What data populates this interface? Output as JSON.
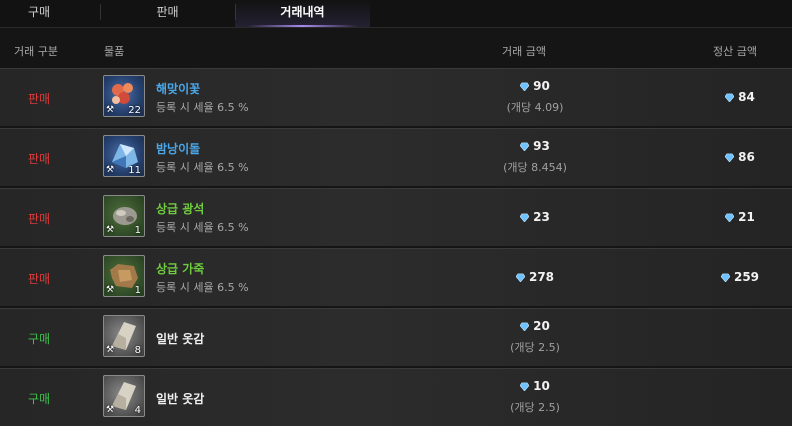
{
  "tabs": [
    "구매",
    "판매",
    "거래내역"
  ],
  "header": {
    "type": "거래 구분",
    "item": "물품",
    "amount": "거래 금액",
    "settle": "정산 금액"
  },
  "rows": [
    {
      "type": "판매",
      "kind": "sell",
      "name": "해맞이꽃",
      "name_color": "blue",
      "tax": "등록 시 세율 6.5 %",
      "count": "22",
      "amount": "90",
      "unit": "(개당 4.09)",
      "settle": "84"
    },
    {
      "type": "판매",
      "kind": "sell",
      "name": "밤낭이돌",
      "name_color": "blue",
      "tax": "등록 시 세율 6.5 %",
      "count": "11",
      "amount": "93",
      "unit": "(개당 8.454)",
      "settle": "86"
    },
    {
      "type": "판매",
      "kind": "sell",
      "name": "상급 광석",
      "name_color": "green",
      "tax": "등록 시 세율 6.5 %",
      "count": "1",
      "amount": "23",
      "unit": "",
      "settle": "21"
    },
    {
      "type": "판매",
      "kind": "sell",
      "name": "상급 가죽",
      "name_color": "green",
      "tax": "등록 시 세율 6.5 %",
      "count": "1",
      "amount": "278",
      "unit": "",
      "settle": "259"
    },
    {
      "type": "구매",
      "kind": "buy",
      "name": "일반 옷감",
      "name_color": "white",
      "tax": "",
      "count": "8",
      "amount": "20",
      "unit": "(개당 2.5)",
      "settle": ""
    },
    {
      "type": "구매",
      "kind": "buy",
      "name": "일반 옷감",
      "name_color": "white",
      "tax": "",
      "count": "4",
      "amount": "10",
      "unit": "(개당 2.5)",
      "settle": ""
    }
  ]
}
